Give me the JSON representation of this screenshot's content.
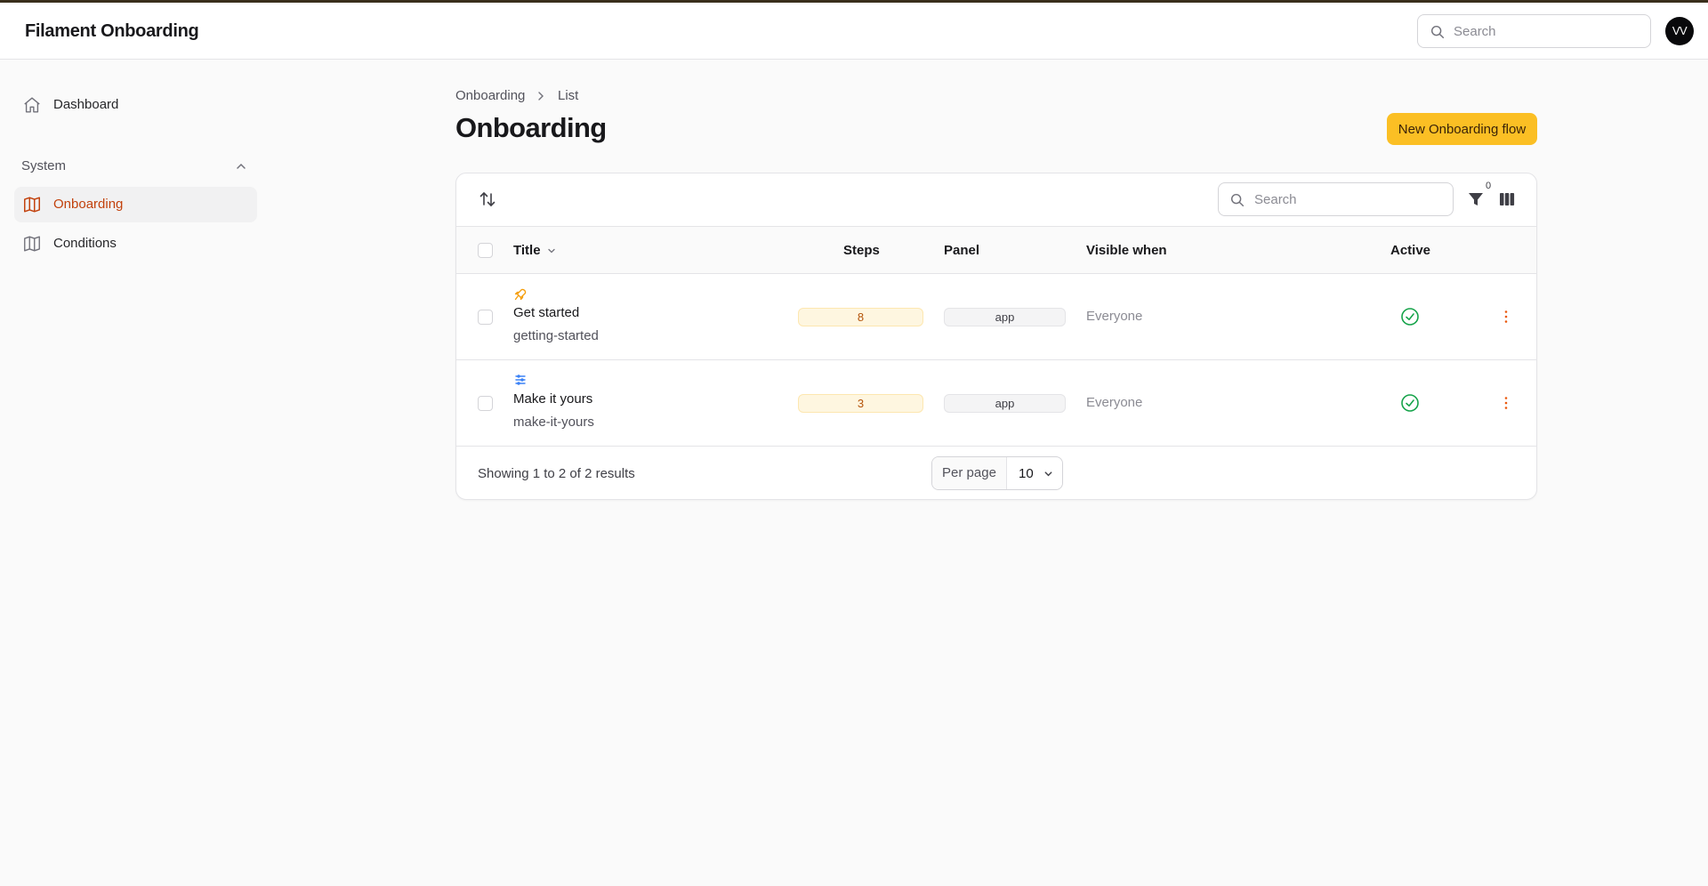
{
  "app": {
    "title": "Filament Onboarding"
  },
  "topbar": {
    "search_placeholder": "Search",
    "avatar_initials": "VV"
  },
  "sidebar": {
    "dashboard_label": "Dashboard",
    "group_label": "System",
    "items": [
      {
        "label": "Onboarding",
        "active": true
      },
      {
        "label": "Conditions",
        "active": false
      }
    ]
  },
  "breadcrumb": {
    "root": "Onboarding",
    "current": "List"
  },
  "page": {
    "title": "Onboarding",
    "new_button": "New Onboarding flow"
  },
  "table": {
    "search_placeholder": "Search",
    "filter_count": "0",
    "columns": {
      "title": "Title",
      "steps": "Steps",
      "panel": "Panel",
      "visible_when": "Visible when",
      "active": "Active"
    },
    "rows": [
      {
        "icon": "rocket-icon",
        "title": "Get started",
        "slug": "getting-started",
        "steps": "8",
        "panel": "app",
        "visible_when": "Everyone",
        "active": true
      },
      {
        "icon": "list-icon",
        "title": "Make it yours",
        "slug": "make-it-yours",
        "steps": "3",
        "panel": "app",
        "visible_when": "Everyone",
        "active": true
      }
    ],
    "footer": {
      "summary": "Showing 1 to 2 of 2 results",
      "per_page_label": "Per page",
      "per_page_value": "10"
    }
  },
  "colors": {
    "accent": "#fbbf24",
    "active_nav": "#c2410c",
    "success": "#16a34a"
  }
}
